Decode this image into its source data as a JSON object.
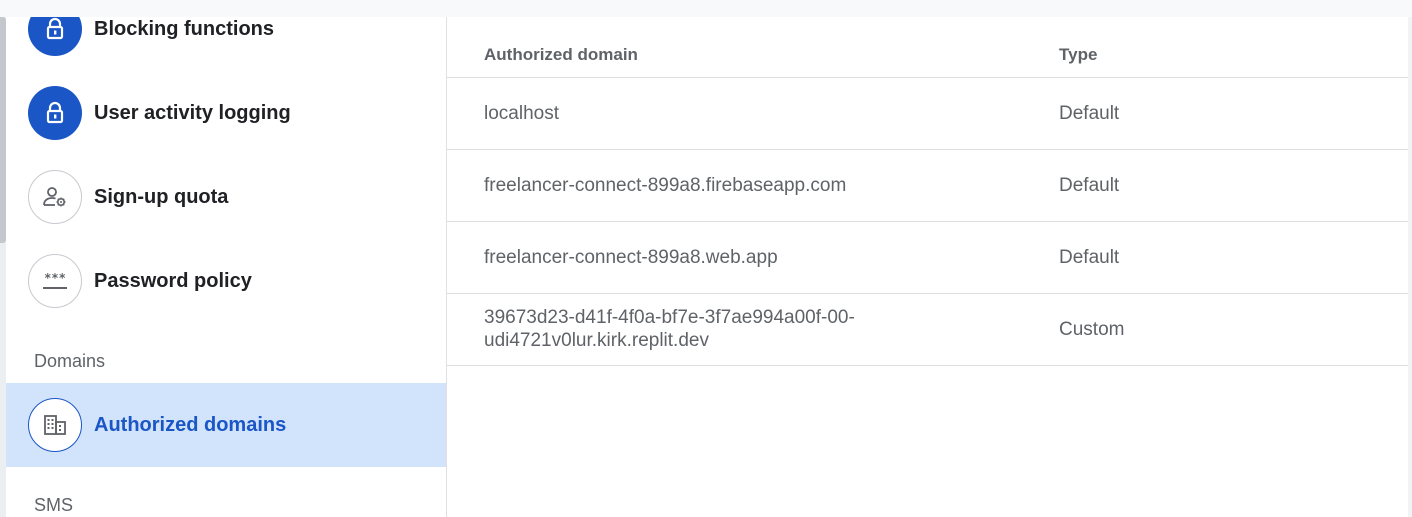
{
  "sidebar": {
    "items": [
      {
        "label": "Blocking functions",
        "icon": "lock-icon"
      },
      {
        "label": "User activity logging",
        "icon": "lock-icon"
      },
      {
        "label": "Sign-up quota",
        "icon": "user-settings-icon"
      },
      {
        "label": "Password policy",
        "icon": "password-icon"
      }
    ],
    "sections": [
      {
        "title": "Domains"
      },
      {
        "title": "SMS"
      }
    ],
    "selected": {
      "label": "Authorized domains",
      "icon": "building-icon"
    }
  },
  "table": {
    "columns": [
      "Authorized domain",
      "Type"
    ],
    "rows": [
      {
        "domain": "localhost",
        "type": "Default"
      },
      {
        "domain": "freelancer-connect-899a8.firebaseapp.com",
        "type": "Default"
      },
      {
        "domain": "freelancer-connect-899a8.web.app",
        "type": "Default"
      },
      {
        "domain_line1": "39673d23-d41f-4f0a-bf7e-3f7ae994a00f-00-",
        "domain_line2": "udi4721v0lur.kirk.replit.dev",
        "type": "Custom"
      }
    ]
  },
  "colors": {
    "accent": "#1a56c6",
    "selected_bg": "#d2e3fc",
    "text_muted": "#5f6368"
  }
}
